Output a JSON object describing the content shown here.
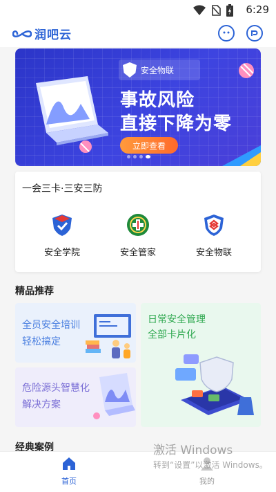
{
  "status_bar": {
    "time": "6:29",
    "icons": [
      "wifi-icon",
      "no-sim-icon",
      "battery-charging-icon"
    ]
  },
  "header": {
    "logo_text": "润吧云",
    "icons": [
      "chat-bubble-icon",
      "profile-badge-icon"
    ]
  },
  "banner": {
    "brand_label": "安全物联",
    "headline_line1": "事故风险",
    "headline_line2": "直接下降为零",
    "cta_label": "立即查看",
    "page_count": 4,
    "active_page": 4
  },
  "feature_card": {
    "title": "一会三卡·三安三防",
    "apps": [
      {
        "label": "安全学院",
        "icon": "graduation-shield-icon"
      },
      {
        "label": "安全管家",
        "icon": "shield-cross-badge-icon"
      },
      {
        "label": "安全物联",
        "icon": "link-shield-icon"
      }
    ]
  },
  "recommend": {
    "title": "精品推荐",
    "items": [
      {
        "line1": "全员安全培训",
        "line2": "轻松搞定"
      },
      {
        "line1": "危险源头智慧化",
        "line2": "解决方案"
      },
      {
        "line1": "日常安全管理",
        "line2": "全部卡片化"
      }
    ]
  },
  "cases": {
    "title": "经典案例"
  },
  "watermark": {
    "line1": "激活 Windows",
    "line2": "转到“设置”以激活 Windows。"
  },
  "tabbar": {
    "tabs": [
      {
        "label": "首页",
        "active": true
      },
      {
        "label": "我的",
        "active": false
      }
    ]
  },
  "colors": {
    "brand_blue": "#2c63d6",
    "banner_bg": "#3a40dc",
    "cta_orange": "#ff7f32",
    "rec_blue_text": "#4a7fe0",
    "rec_purple_text": "#7b6fd6",
    "rec_green_text": "#2ea84f"
  }
}
